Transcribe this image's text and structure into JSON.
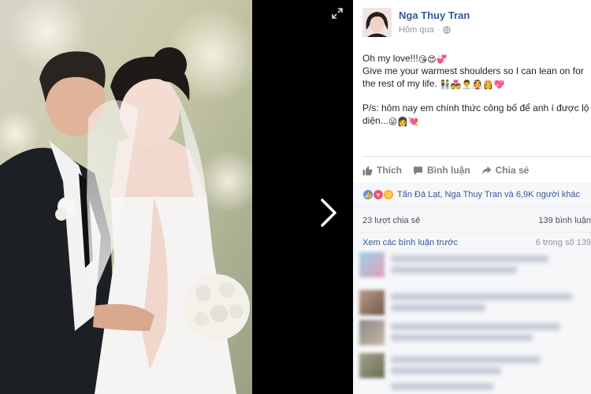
{
  "post": {
    "author": "Nga Thuy Tran",
    "timestamp": "Hôm qua",
    "line1": "Oh my love!!!",
    "line1_emoji": "😘😍💞",
    "line2": "Give me your warmest shoulders so I can lean on for the rest of my life.",
    "line2_emoji": "👫💑👨‍💼👰👸💖",
    "line3": "P/s: hôm nay em chính thức công bố để anh í được lộ diện...",
    "line3_emoji": "😜👩💘"
  },
  "actions": {
    "like": "Thích",
    "comment": "Bình luận",
    "share": "Chia sẻ"
  },
  "reactions": {
    "summary": "Tấn Đà Lạt, Nga Thuy Tran và 6,9K người khác",
    "colors": {
      "like": "#5890ff",
      "love": "#f25268",
      "wow": "#f7b125"
    }
  },
  "stats": {
    "shares": "23 lượt chia sẻ",
    "comments": "139 bình luận"
  },
  "comments_section": {
    "view_previous": "Xem các bình luận trước",
    "count": "6 trong số 139"
  },
  "icons": {
    "expand": "expand-icon",
    "next": "chevron-right-icon",
    "globe": "globe-icon",
    "like": "thumbs-up-icon",
    "comment": "speech-bubble-icon",
    "share": "share-arrow-icon"
  },
  "colors": {
    "link": "#365899",
    "secondary_text": "#90949c",
    "panel_bg": "#f6f7f9"
  }
}
